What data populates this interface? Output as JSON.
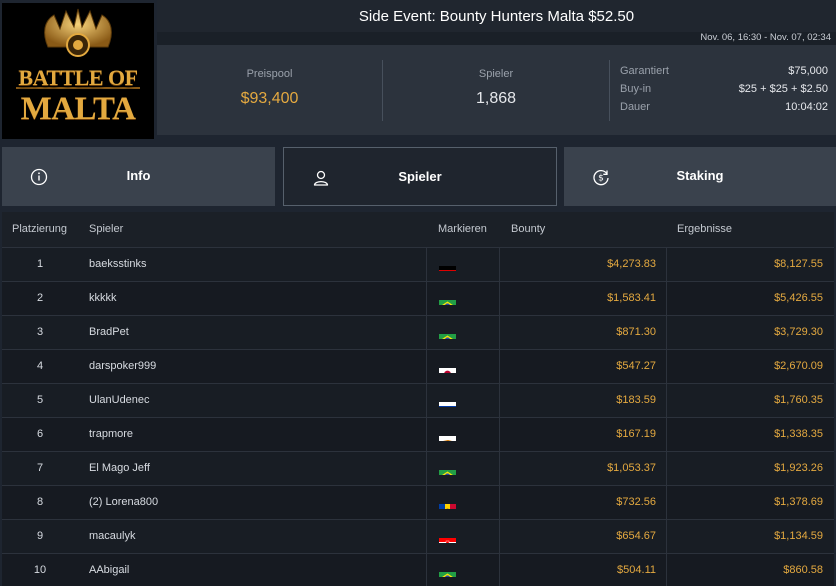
{
  "logo": {
    "line1": "BATTLE OF",
    "line2": "MALTA"
  },
  "event": {
    "title": "Side Event: Bounty Hunters Malta $52.50",
    "dates": "Nov. 06, 16:30 - Nov. 07, 02:34"
  },
  "stats": {
    "prizepool_label": "Preispool",
    "prizepool_value": "$93,400",
    "players_label": "Spieler",
    "players_value": "1,868",
    "details": [
      {
        "key": "Garantiert",
        "value": "$75,000"
      },
      {
        "key": "Buy-in",
        "value": "$25 + $25 + $2.50"
      },
      {
        "key": "Dauer",
        "value": "10:04:02"
      }
    ]
  },
  "tabs": [
    {
      "label": "Info",
      "icon": "info-icon",
      "active": false
    },
    {
      "label": "Spieler",
      "icon": "user-icon",
      "active": true
    },
    {
      "label": "Staking",
      "icon": "money-cycle-icon",
      "active": false
    }
  ],
  "table": {
    "headers": {
      "rank": "Platzierung",
      "player": "Spieler",
      "flag": "Markieren",
      "bounty": "Bounty",
      "result": "Ergebnisse"
    },
    "rows": [
      {
        "rank": "1",
        "player": "baeksstinks",
        "flag": "germany",
        "bounty": "$4,273.83",
        "result": "$8,127.55"
      },
      {
        "rank": "2",
        "player": "kkkkk",
        "flag": "brazil",
        "bounty": "$1,583.41",
        "result": "$5,426.55"
      },
      {
        "rank": "3",
        "player": "BradPet",
        "flag": "brazil",
        "bounty": "$871.30",
        "result": "$3,729.30"
      },
      {
        "rank": "4",
        "player": "darspoker999",
        "flag": "japan",
        "bounty": "$547.27",
        "result": "$2,670.09"
      },
      {
        "rank": "5",
        "player": "UlanUdenec",
        "flag": "russia",
        "bounty": "$183.59",
        "result": "$1,760.35"
      },
      {
        "rank": "6",
        "player": "trapmore",
        "flag": "cyprus",
        "bounty": "$167.19",
        "result": "$1,338.35"
      },
      {
        "rank": "7",
        "player": "El Mago Jeff",
        "flag": "brazil",
        "bounty": "$1,053.37",
        "result": "$1,923.26"
      },
      {
        "rank": "8",
        "player": "(2) Lorena800",
        "flag": "moldova",
        "bounty": "$732.56",
        "result": "$1,378.69"
      },
      {
        "rank": "9",
        "player": "macaulyk",
        "flag": "croatia",
        "bounty": "$654.67",
        "result": "$1,134.59"
      },
      {
        "rank": "10",
        "player": "AAbigail",
        "flag": "brazil",
        "bounty": "$504.11",
        "result": "$860.58"
      }
    ]
  },
  "colors": {
    "accent_gold": "#e4a940",
    "background": "#1e2530",
    "panel": "#2c333d"
  }
}
